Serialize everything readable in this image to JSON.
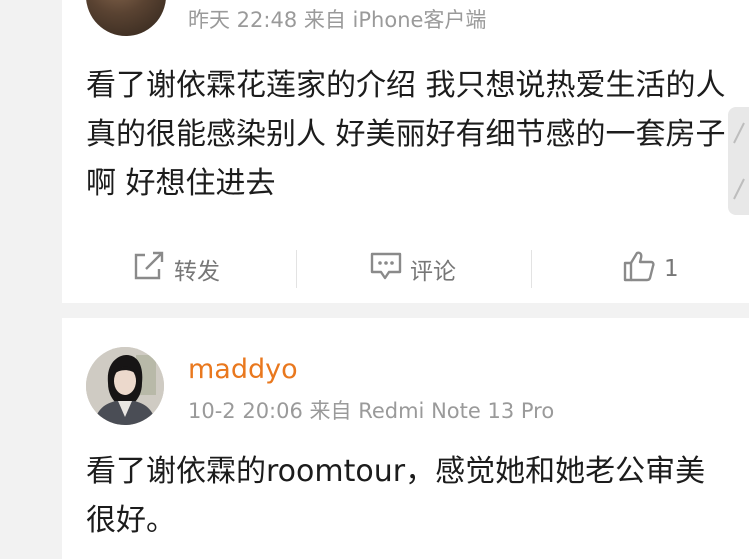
{
  "post1": {
    "meta": "昨天 22:48 来自 iPhone客户端",
    "text": "看了谢依霖花莲家的介绍 我只想说热爱生活的人真的很能感染别人 好美丽好有细节感的一套房子啊 好想住进去",
    "actions": {
      "forward_label": "转发",
      "comment_label": "评论",
      "like_count": "1"
    }
  },
  "post2": {
    "username": "maddyo",
    "meta": "10-2 20:06 来自 Redmi Note 13 Pro",
    "text": "看了谢依霖的roomtour，感觉她和她老公审美很好。"
  },
  "colors": {
    "username": "#e9781e",
    "meta": "#9a9a9a",
    "text": "#1c1c1c",
    "background": "#f2f2f2"
  },
  "icons": [
    "forward-icon",
    "comment-icon",
    "like-icon",
    "side-panel-chevron-icon"
  ]
}
